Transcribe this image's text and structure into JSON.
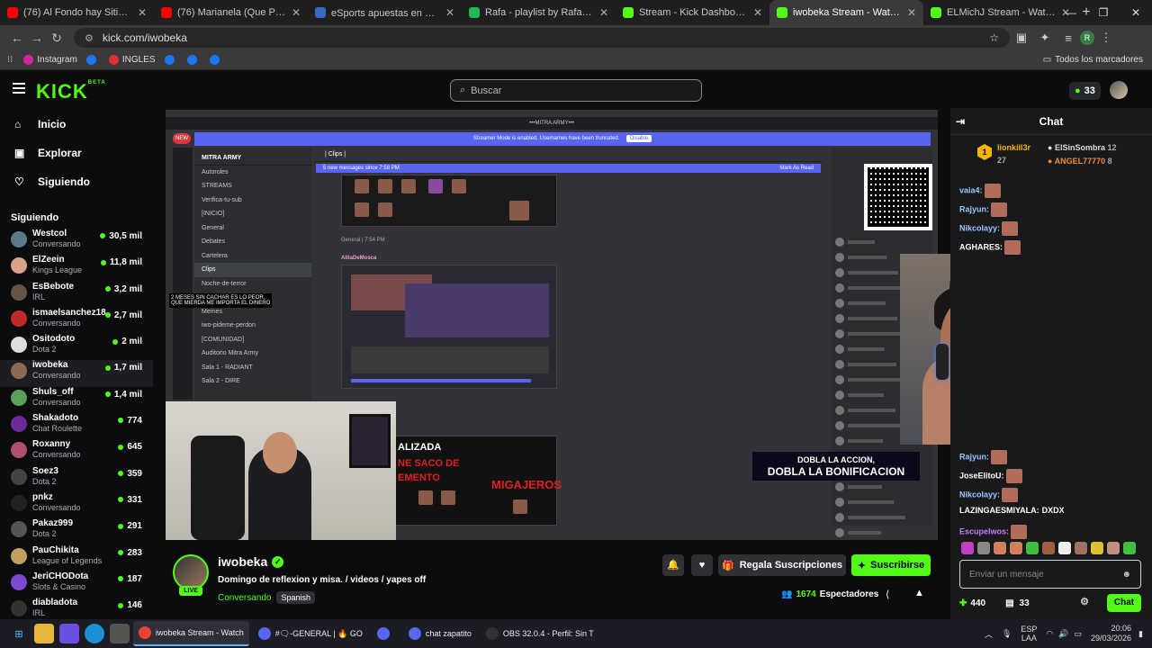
{
  "browser": {
    "tabs": [
      {
        "label": "(76) Al Fondo hay Sitio 8: Ferna",
        "color": "#ff0000"
      },
      {
        "label": "(76) Marianela (Que Pasa) (Exte",
        "color": "#ff0000"
      },
      {
        "label": "eSports apuestas en directo ▶",
        "color": "#3b6cc5"
      },
      {
        "label": "Rafa - playlist by RafaeLxared |",
        "color": "#1db954"
      },
      {
        "label": "Stream - Kick Dashboard",
        "color": "#53fc18"
      },
      {
        "label": "iwobeka Stream - Watch Li",
        "color": "#53fc18",
        "active": true
      },
      {
        "label": "ELMichJ Stream - Watch Live c",
        "color": "#53fc18"
      }
    ],
    "url": "kick.com/iwobeka",
    "profile_initial": "R",
    "bookmarks": [
      {
        "label": "Instagram",
        "color": "#d6249f"
      },
      {
        "label": "",
        "color": "#1877f2"
      },
      {
        "label": "INGLES",
        "color": "#e03030"
      },
      {
        "label": "",
        "color": "#1877f2"
      },
      {
        "label": "",
        "color": "#1877f2"
      },
      {
        "label": "",
        "color": "#1877f2"
      }
    ],
    "all_bookmarks": "Todos los marcadores"
  },
  "kick": {
    "logo": "KICK",
    "logo_badge": "BETA",
    "search_placeholder": "Buscar",
    "coins": "33"
  },
  "sidebar": {
    "nav": [
      {
        "label": "Inicio",
        "icon": "home-icon"
      },
      {
        "label": "Explorar",
        "icon": "explore-icon"
      },
      {
        "label": "Siguiendo",
        "icon": "heart-icon"
      }
    ],
    "following_title": "Siguiendo",
    "following": [
      {
        "name": "Westcol",
        "category": "Conversando",
        "viewers": "30,5 mil",
        "color": "#5a7a8a"
      },
      {
        "name": "ElZeein",
        "category": "Kings League",
        "viewers": "11,8 mil",
        "color": "#d9a08a"
      },
      {
        "name": "EsBebote",
        "category": "IRL",
        "viewers": "3,2 mil",
        "color": "#665544"
      },
      {
        "name": "ismaelsanchez18",
        "category": "Conversando",
        "viewers": "2,7 mil",
        "color": "#c02a2a"
      },
      {
        "name": "Ositodoto",
        "category": "Dota 2",
        "viewers": "2 mil",
        "color": "#dddddd"
      },
      {
        "name": "iwobeka",
        "category": "Conversando",
        "viewers": "1,7 mil",
        "color": "#8a6a55",
        "active": true
      },
      {
        "name": "Shuls_off",
        "category": "Conversando",
        "viewers": "1,4 mil",
        "color": "#5aa05a"
      },
      {
        "name": "Shakadoto",
        "category": "Chat Roulette",
        "viewers": "774",
        "color": "#6a2a9a"
      },
      {
        "name": "Roxanny",
        "category": "Conversando",
        "viewers": "645",
        "color": "#b05070"
      },
      {
        "name": "Soez3",
        "category": "Dota 2",
        "viewers": "359",
        "color": "#444444"
      },
      {
        "name": "pnkz",
        "category": "Conversando",
        "viewers": "331",
        "color": "#222222"
      },
      {
        "name": "Pakaz999",
        "category": "Dota 2",
        "viewers": "291",
        "color": "#555555"
      },
      {
        "name": "PauChikita",
        "category": "League of Legends",
        "viewers": "283",
        "color": "#c0a060"
      },
      {
        "name": "JeriCHODota",
        "category": "Slots & Casino",
        "viewers": "187",
        "color": "#7a4ad0"
      },
      {
        "name": "diabladota",
        "category": "IRL",
        "viewers": "146",
        "color": "#333333"
      }
    ]
  },
  "stream_overlay": {
    "server": "•••MITRA ARMY•••",
    "streamer_mode": "Streamer Mode is enabled. Usernames have been truncated.",
    "disable": "Disable",
    "new_badge": "NEW",
    "channel_header": "MITRA ARMY",
    "channels": [
      "Autoroles",
      "STREAMS",
      "Verifica-tu-sub",
      "[INICIO]",
      "General",
      "Debates",
      "Cartelera",
      "Clips",
      "Noche-de-terror",
      "Como-sub-aunban",
      "Memes",
      "iwo-pideme-perdon",
      "[COMUNIDAD]",
      "Auditorio Mitra Army",
      "Sala 1 - RADIANT",
      "Sala 2 - DIRE"
    ],
    "clips_header": "| Clips |",
    "new_messages": "5 new messages since 7:58 PM",
    "mark_read": "Mark As Read",
    "general_time": "General | 7:54 PM",
    "author": "AlitaDeMosca",
    "chat_line1": "2 MESES SIN CACHAR ES LO PEOR,",
    "chat_line2": "QUE MIERDA ME IMPORTA EL DINERO",
    "actualizada": "ALIZADA",
    "ne_saco": "NE SACO DE",
    "mento": "EMENTO",
    "migajeros": "MIGAJEROS",
    "dobla1": "DOBLA LA ACCION,",
    "dobla2": "DOBLA LA BONIFICACION"
  },
  "channel": {
    "name": "iwobeka",
    "live": "LIVE",
    "title": "Domingo de reflexion y misa.  /   videos / yapes off",
    "category": "Conversando",
    "tag": "Spanish",
    "gift_label": "Regala Suscripciones",
    "subscribe_label": "Suscribirse",
    "viewers": "1674",
    "viewers_label": "Espectadores"
  },
  "chat": {
    "title": "Chat",
    "leaderboard": [
      {
        "name": "lionkill3r",
        "count": "27",
        "color": "#f5b400"
      },
      {
        "name": "ElSinSombra",
        "count": "12",
        "color": "#dddddd"
      },
      {
        "name": "ANGEL77770",
        "count": "8",
        "color": "#f08a3a"
      }
    ],
    "rank": "1",
    "messages": [
      {
        "user": "vaia4:",
        "text": "",
        "color": "#9fc5ff"
      },
      {
        "user": "Rajyun:",
        "text": "",
        "color": "#9fc5ff"
      },
      {
        "user": "Nikcolayy:",
        "text": "",
        "color": "#9fc5ff"
      },
      {
        "user": "AGHARES:",
        "text": "",
        "color": "#ffffff"
      },
      {
        "user": "Rajyun:",
        "text": "",
        "color": "#9fc5ff"
      },
      {
        "user": "JoseElitoU:",
        "text": "",
        "color": "#ffffff"
      },
      {
        "user": "Nikcolayy:",
        "text": "",
        "color": "#9fc5ff"
      },
      {
        "user": "LAZINGAESMIYALA:",
        "text": "DXDX",
        "color": "#ffffff"
      },
      {
        "user": "Escupelwos:",
        "text": "",
        "color": "#c77dff"
      }
    ],
    "input_placeholder": "Enviar un mensaje",
    "points": "440",
    "store_count": "33",
    "send_label": "Chat"
  },
  "taskbar": {
    "apps": [
      {
        "label": "iwobeka Stream - Watch",
        "color": "#ea4335",
        "active": true
      },
      {
        "label": "#🗨-GENERAL | 🔥 GO",
        "color": "#5865f2"
      },
      {
        "label": "",
        "color": "#5865f2"
      },
      {
        "label": "chat zapatito",
        "color": "#5865f2"
      },
      {
        "label": "OBS 32.0.4 - Perfil: Sin T",
        "color": "#333333"
      }
    ],
    "lang1": "ESP",
    "lang2": "LAA",
    "time": "20:06",
    "date": "29/03/2026"
  },
  "colors": {
    "kick_green": "#53fc18",
    "bg": "#0b0c0e"
  }
}
